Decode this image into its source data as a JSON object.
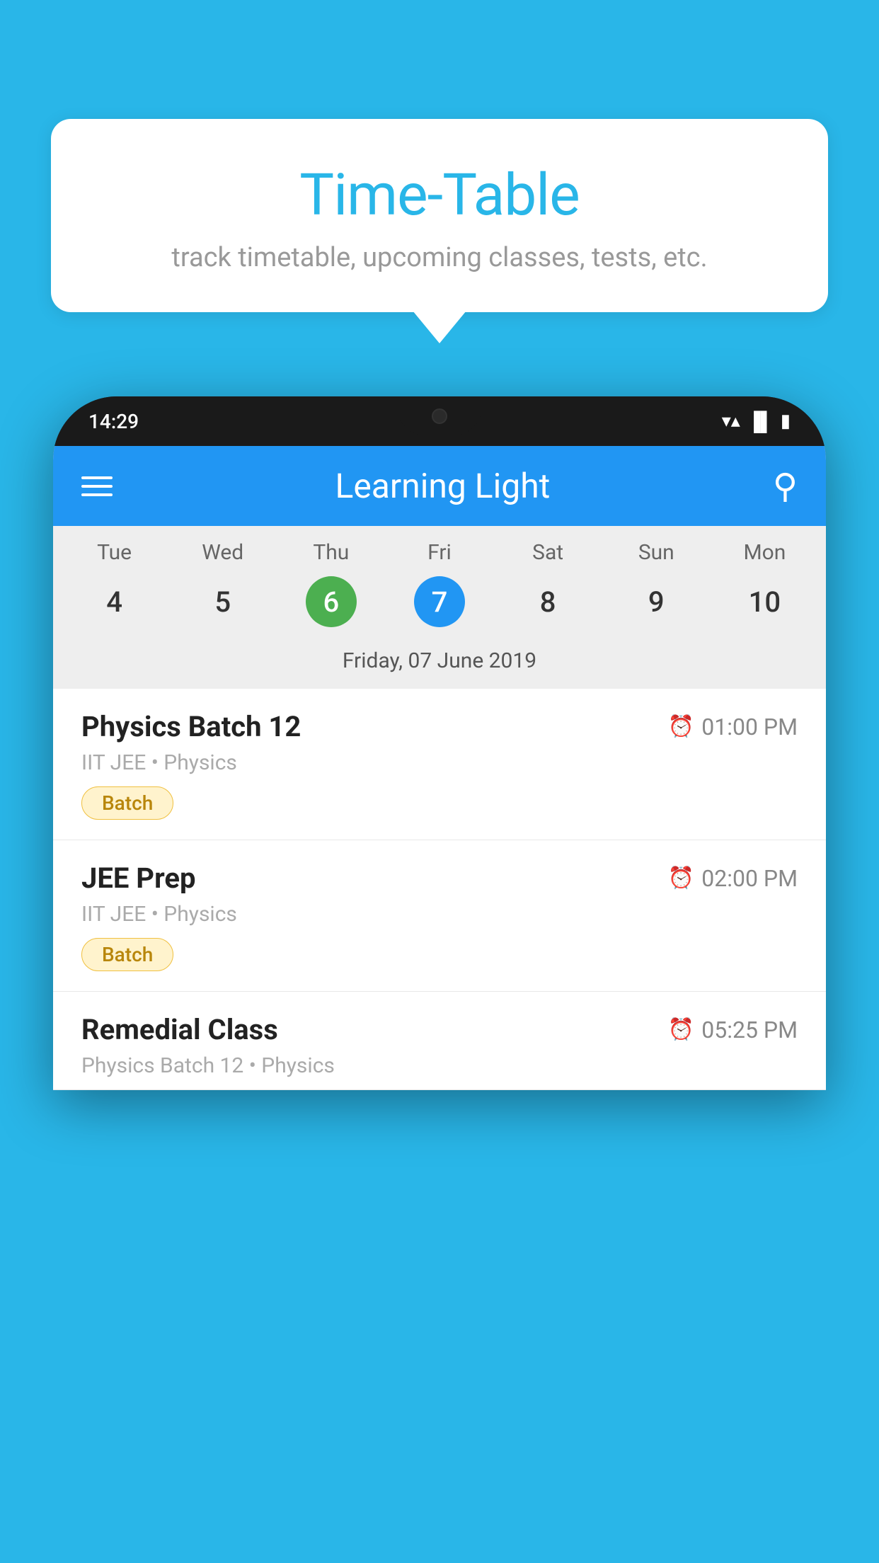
{
  "background_color": "#29b6e8",
  "speech_bubble": {
    "title": "Time-Table",
    "subtitle": "track timetable, upcoming classes, tests, etc."
  },
  "phone": {
    "status_bar": {
      "time": "14:29",
      "icons": [
        "wifi",
        "signal",
        "battery"
      ]
    },
    "app_header": {
      "title": "Learning Light",
      "menu_icon": "hamburger",
      "search_icon": "search"
    },
    "calendar": {
      "days": [
        "Tue",
        "Wed",
        "Thu",
        "Fri",
        "Sat",
        "Sun",
        "Mon"
      ],
      "dates": [
        "4",
        "5",
        "6",
        "7",
        "8",
        "9",
        "10"
      ],
      "today_index": 2,
      "selected_index": 3,
      "selected_date_label": "Friday, 07 June 2019"
    },
    "schedule_items": [
      {
        "title": "Physics Batch 12",
        "time": "01:00 PM",
        "meta": "IIT JEE • Physics",
        "badge": "Batch"
      },
      {
        "title": "JEE Prep",
        "time": "02:00 PM",
        "meta": "IIT JEE • Physics",
        "badge": "Batch"
      },
      {
        "title": "Remedial Class",
        "time": "05:25 PM",
        "meta": "Physics Batch 12 • Physics",
        "badge": null
      }
    ]
  }
}
